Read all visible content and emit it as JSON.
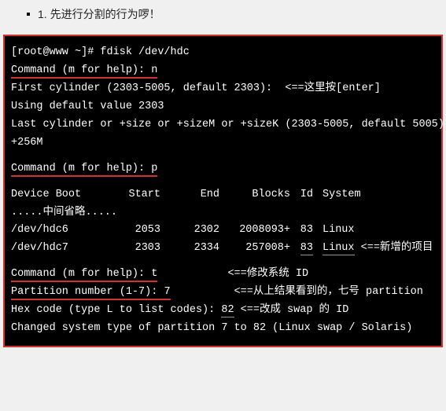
{
  "intro": {
    "bullet_text": "1. 先进行分割的行为啰！"
  },
  "terminal": {
    "prompt": "[root@www ~]# fdisk /dev/hdc",
    "cmd1_label": "Command (m for help): ",
    "cmd1_input": "n",
    "first_cyl": "First cylinder (2303-5005, default 2303):  <==这里按[enter]",
    "using_default": "Using default value 2303",
    "last_cyl_1": "Last cylinder or +size or +sizeM or +sizeK (2303-5005, default 5005): ",
    "last_cyl_2": "+256M",
    "cmd2_label": "Command (m for help): ",
    "cmd2_input": "p",
    "table": {
      "hdr_device": "   Device Boot",
      "hdr_start": "Start",
      "hdr_end": "End",
      "hdr_blocks": "Blocks",
      "hdr_id": "Id",
      "hdr_system": "System",
      "omit": ".....中间省略.....",
      "r1_dev": "/dev/hdc6",
      "r1_start": "2053",
      "r1_end": "2302",
      "r1_blocks": "2008093+",
      "r1_id": "83",
      "r1_sys": "Linux",
      "r2_dev": "/dev/hdc7",
      "r2_start": "2303",
      "r2_end": "2334",
      "r2_blocks": "257008+",
      "r2_id": "83",
      "r2_sys": "Linux",
      "r2_note": " <==新增的项目"
    },
    "cmd3_label": "Command (m for help): ",
    "cmd3_input": "t",
    "cmd3_note": "           <==修改系统 ID",
    "partnum_label": "Partition number (1-7): ",
    "partnum_input": "7",
    "partnum_note": "          <==从上结果看到的，七号 partition",
    "hex_label": "Hex code (type L to list codes): ",
    "hex_input": "82",
    "hex_note": " <==改成 swap 的 ID",
    "changed": "Changed system type of partition 7 to 82 (Linux swap / Solaris)"
  }
}
